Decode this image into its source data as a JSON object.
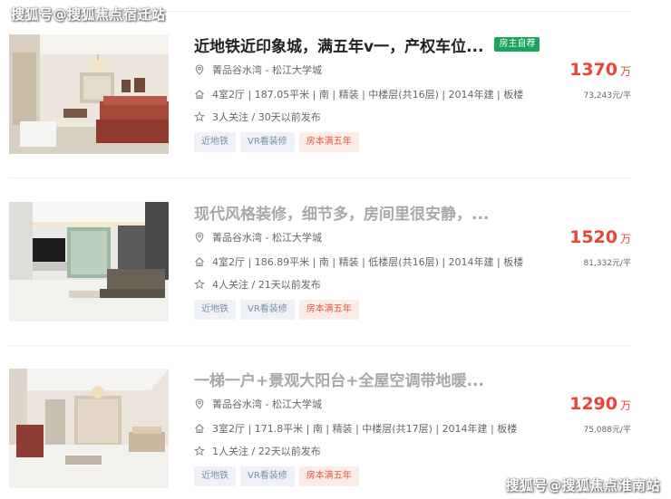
{
  "watermarks": {
    "top": "搜狐号@搜狐焦点宿迁站",
    "bottom": "搜狐号@搜狐焦点淮南站"
  },
  "colors": {
    "price_red": "#e8443a",
    "owner_badge_green": "#1aa35a",
    "tag_blue_bg": "#eef2f7",
    "tag_red_bg": "#fcece8"
  },
  "listings": [
    {
      "title": "近地铁近印象城，满五年v一，产权车位...",
      "badge": "房主自荐",
      "location": "菁品谷水湾 - 松江大学城",
      "details": "4室2厅 | 187.05平米 | 南 | 精装 | 中楼层(共16层) | 2014年建 | 板楼",
      "followers": "3人关注 / 30天以前发布",
      "price": "1370",
      "price_unit": "万",
      "unit_price": "73,243元/平",
      "tags": [
        "近地铁",
        "VR看装修",
        "房本满五年"
      ]
    },
    {
      "title": "现代风格装修，细节多，房间里很安静，...",
      "badge": "",
      "location": "菁品谷水湾 - 松江大学城",
      "details": "4室2厅 | 186.89平米 | 南 | 精装 | 低楼层(共16层) | 2014年建 | 板楼",
      "followers": "4人关注 / 21天以前发布",
      "price": "1520",
      "price_unit": "万",
      "unit_price": "81,332元/平",
      "tags": [
        "近地铁",
        "VR看装修",
        "房本满五年"
      ]
    },
    {
      "title": "一梯一户+景观大阳台+全屋空调带地暖...",
      "badge": "",
      "location": "菁品谷水湾 - 松江大学城",
      "details": "3室2厅 | 171.8平米 | 南 | 精装 | 中楼层(共17层) | 2014年建 | 板楼",
      "followers": "1人关注 / 22天以前发布",
      "price": "1290",
      "price_unit": "万",
      "unit_price": "75,088元/平",
      "tags": [
        "近地铁",
        "VR看装修",
        "房本满五年"
      ]
    }
  ]
}
